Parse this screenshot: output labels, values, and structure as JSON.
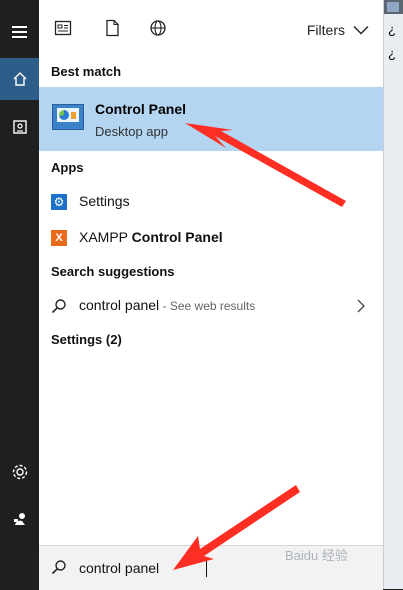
{
  "left_rail": {
    "menu_icon": "hamburger-icon",
    "home_icon": "home-icon",
    "notebook_icon": "notebook-icon",
    "settings_icon": "gear-icon",
    "feedback_icon": "feedback-icon"
  },
  "header": {
    "filters_label": "Filters",
    "apps_filter_icon": "apps-filter-icon",
    "documents_filter_icon": "document-icon",
    "web_filter_icon": "globe-icon"
  },
  "best_match": {
    "section_label": "Best match",
    "title": "Control Panel",
    "subtitle": "Desktop app"
  },
  "apps": {
    "section_label": "Apps",
    "items": [
      {
        "label": "Settings",
        "icon": "settings-app-icon"
      },
      {
        "label_plain": "XAMPP ",
        "label_bold": "Control Panel",
        "icon": "xampp-icon"
      }
    ]
  },
  "search_suggestions": {
    "section_label": "Search suggestions",
    "item": {
      "query": "control panel",
      "suffix": " - See web results"
    }
  },
  "settings_group": {
    "label": "Settings (2)"
  },
  "search": {
    "value": "control panel"
  },
  "desktop": {
    "text1": "¿",
    "text2": "¿"
  },
  "watermark": "Baidu 经验",
  "colors": {
    "highlight": "#b3d5f2",
    "rail": "#1f1f1f",
    "rail_active": "#2d5e8a",
    "arrow": "#ff3b2f"
  }
}
